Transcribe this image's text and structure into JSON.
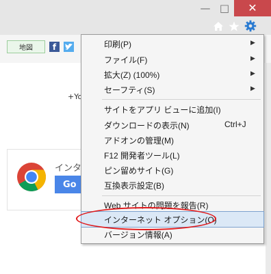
{
  "window_controls": {
    "minimize": "—",
    "maximize": "□",
    "close": "✕"
  },
  "toolbar": {
    "home_icon": "home-icon",
    "favorites_icon": "star-icon",
    "tools_icon": "gear-icon"
  },
  "favorites_bar": {
    "map_label": "地図",
    "facebook_icon": "f",
    "twitter_icon": "🐦"
  },
  "page": {
    "yahoo_partial": "+Yo",
    "chrome_promo_partial": "インタ",
    "chrome_button_partial": "Go"
  },
  "colors": {
    "highlight": "#dbe8f6",
    "annotation_red": "#e0191b"
  },
  "tools_menu": {
    "items": [
      {
        "label": "印刷(P)",
        "has_submenu": true
      },
      {
        "label": "ファイル(F)",
        "has_submenu": true
      },
      {
        "label": "拡大(Z) (100%)",
        "has_submenu": true
      },
      {
        "label": "セーフティ(S)",
        "has_submenu": true
      },
      {
        "label": "サイトをアプリ ビューに追加(I)"
      },
      {
        "label": "ダウンロードの表示(N)",
        "shortcut": "Ctrl+J"
      },
      {
        "label": "アドオンの管理(M)"
      },
      {
        "label": "F12 開発者ツール(L)"
      },
      {
        "label": "ピン留めサイト(G)"
      },
      {
        "label": "互換表示設定(B)"
      },
      {
        "label": "Web サイトの問題を報告(R)"
      },
      {
        "label": "インターネット オプション(O)",
        "highlighted": true
      },
      {
        "label": "バージョン情報(A)"
      }
    ]
  }
}
